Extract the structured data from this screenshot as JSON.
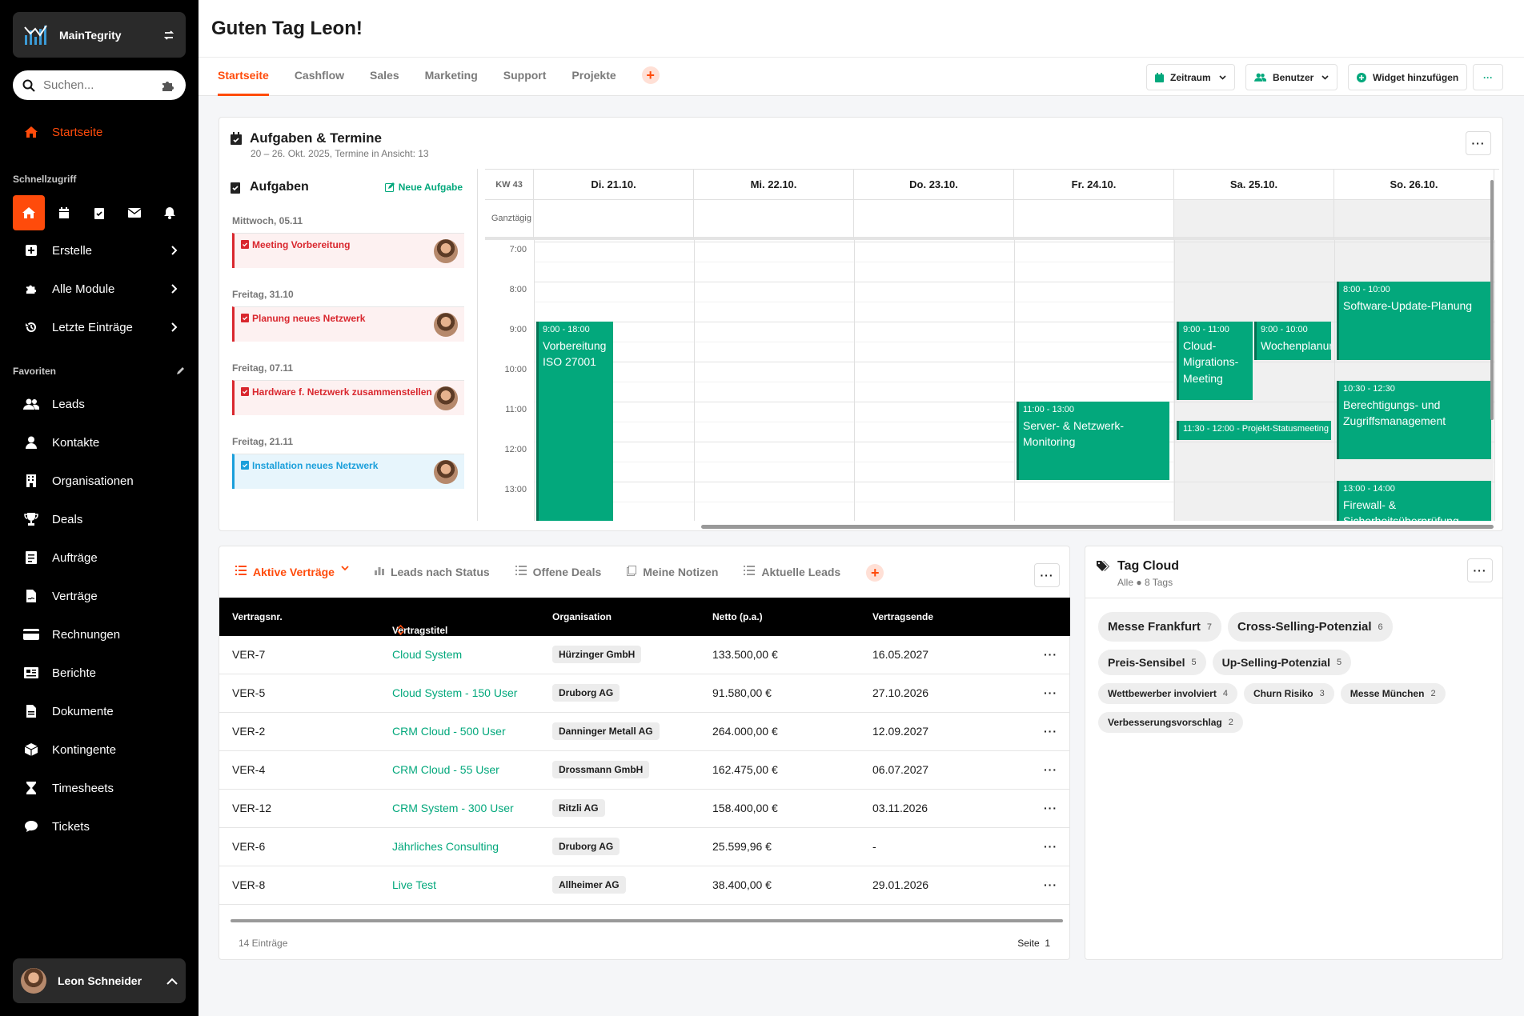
{
  "app": {
    "name": "MainTegrity"
  },
  "search": {
    "placeholder": "Suchen..."
  },
  "nav": {
    "home": "Startseite",
    "quick_title": "Schnellzugriff",
    "create": "Erstelle",
    "modules": "Alle Module",
    "recent": "Letzte Einträge",
    "fav_title": "Favoriten",
    "favorites": [
      "Leads",
      "Kontakte",
      "Organisationen",
      "Deals",
      "Aufträge",
      "Verträge",
      "Rechnungen",
      "Berichte",
      "Dokumente",
      "Kontingente",
      "Timesheets",
      "Tickets"
    ]
  },
  "user": {
    "name": "Leon Schneider"
  },
  "header": {
    "greeting": "Guten Tag Leon!"
  },
  "tabs": [
    "Startseite",
    "Cashflow",
    "Sales",
    "Marketing",
    "Support",
    "Projekte"
  ],
  "toolbar": {
    "zeitraum": "Zeitraum",
    "benutzer": "Benutzer",
    "widget": "Widget hinzufügen"
  },
  "tasks_widget": {
    "title": "Aufgaben & Termine",
    "subtitle": "20 – 26. Okt. 2025, Termine in Ansicht: 13",
    "tasks_title": "Aufgaben",
    "new_task": "Neue Aufgabe",
    "groups": [
      {
        "day": "Mittwoch, 05.11",
        "task": "Meeting Vorbereitung",
        "style": "red"
      },
      {
        "day": "Freitag, 31.10",
        "task": "Planung neues Netzwerk",
        "style": "red"
      },
      {
        "day": "Freitag, 07.11",
        "task": "Hardware f. Netzwerk zusammenstellen",
        "style": "red"
      },
      {
        "day": "Freitag, 21.11",
        "task": "Installation neues Netzwerk",
        "style": "blue"
      }
    ]
  },
  "calendar": {
    "week": "KW 43",
    "allday": "Ganztägig",
    "days": [
      "Di. 21.10.",
      "Mi. 22.10.",
      "Do. 23.10.",
      "Fr. 24.10.",
      "Sa. 25.10.",
      "So. 26.10."
    ],
    "hours": [
      "7:00",
      "8:00",
      "9:00",
      "10:00",
      "11:00",
      "12:00",
      "13:00"
    ],
    "events": [
      {
        "time": "9:00 - 18:00",
        "title": "Vorbereitung ISO 27001"
      },
      {
        "time": "11:00 - 13:00",
        "title": "Server- & Netzwerk-Monitoring"
      },
      {
        "time": "9:00 - 11:00",
        "title": "Cloud-Migrations-Meeting"
      },
      {
        "time": "9:00 - 10:00",
        "title": "Wochenplanung"
      },
      {
        "time": "11:30 - 12:00",
        "title": "Projekt-Statusmeeting"
      },
      {
        "time": "8:00 - 10:00",
        "title": "Software-Update-Planung"
      },
      {
        "time": "10:30 - 12:30",
        "title": "Berechtigungs- und Zugriffsmanagement"
      },
      {
        "time": "13:00 - 14:00",
        "title": "Firewall- & Sicherheitsüberprüfung"
      }
    ]
  },
  "contracts_widget": {
    "tabs": [
      "Aktive Verträge",
      "Leads nach Status",
      "Offene Deals",
      "Meine Notizen",
      "Aktuelle Leads"
    ],
    "columns": [
      "Vertragsnr.",
      "Vertragstitel",
      "Organisation",
      "Netto (p.a.)",
      "Vertragsende"
    ],
    "rows": [
      {
        "nr": "VER-7",
        "title": "Cloud System",
        "org": "Hürzinger GmbH",
        "net": "133.500,00 €",
        "end": "16.05.2027"
      },
      {
        "nr": "VER-5",
        "title": "Cloud System - 150 User",
        "org": "Druborg AG",
        "net": "91.580,00 €",
        "end": "27.10.2026"
      },
      {
        "nr": "VER-2",
        "title": "CRM Cloud - 500 User",
        "org": "Danninger Metall AG",
        "net": "264.000,00 €",
        "end": "12.09.2027"
      },
      {
        "nr": "VER-4",
        "title": "CRM Cloud - 55 User",
        "org": "Drossmann GmbH",
        "net": "162.475,00 €",
        "end": "06.07.2027"
      },
      {
        "nr": "VER-12",
        "title": "CRM System - 300 User",
        "org": "Ritzli AG",
        "net": "158.400,00 €",
        "end": "03.11.2026"
      },
      {
        "nr": "VER-6",
        "title": "Jährliches Consulting",
        "org": "Druborg AG",
        "net": "25.599,96 €",
        "end": "-"
      },
      {
        "nr": "VER-8",
        "title": "Live Test",
        "org": "Allheimer AG",
        "net": "38.400,00 €",
        "end": "29.01.2026"
      }
    ],
    "footer_count": "14 Einträge",
    "footer_page": "Seite",
    "footer_page_num": "1"
  },
  "tagcloud": {
    "title": "Tag Cloud",
    "filter": "Alle",
    "count": "8 Tags",
    "tags": [
      {
        "name": "Messe Frankfurt",
        "count": "7",
        "size": "l"
      },
      {
        "name": "Cross-Selling-Potenzial",
        "count": "6",
        "size": "l"
      },
      {
        "name": "Preis-Sensibel",
        "count": "5",
        "size": "m"
      },
      {
        "name": "Up-Selling-Potenzial",
        "count": "5",
        "size": "m"
      },
      {
        "name": "Wettbewerber involviert",
        "count": "4",
        "size": "s"
      },
      {
        "name": "Churn Risiko",
        "count": "3",
        "size": "s"
      },
      {
        "name": "Messe München",
        "count": "2",
        "size": "s"
      },
      {
        "name": "Verbesserungsvorschlag",
        "count": "2",
        "size": "s"
      }
    ]
  },
  "colors": {
    "accent": "#ff4b0b",
    "event": "#03a87c",
    "task_red": "#d9272e",
    "task_blue": "#1a9fdb"
  }
}
